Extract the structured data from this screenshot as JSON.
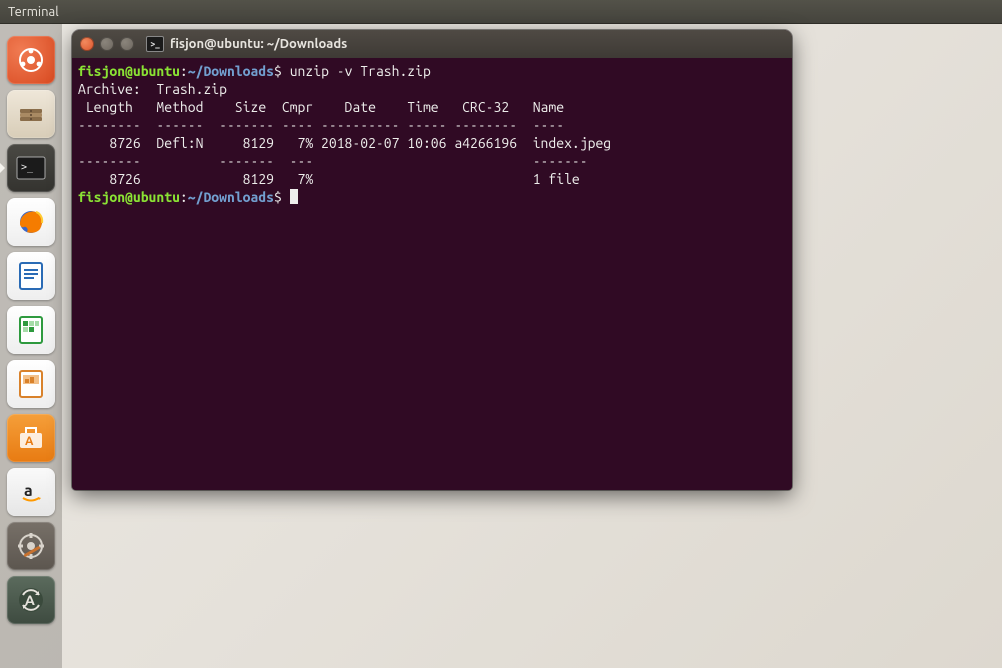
{
  "menubar": {
    "title": "Terminal"
  },
  "launcher": {
    "items": [
      {
        "name": "dash-icon",
        "cls": "li-dash"
      },
      {
        "name": "files-icon",
        "cls": "li-files"
      },
      {
        "name": "terminal-icon",
        "cls": "li-term",
        "active": true
      },
      {
        "name": "firefox-icon",
        "cls": "li-fox"
      },
      {
        "name": "writer-icon",
        "cls": "li-writer"
      },
      {
        "name": "calc-icon",
        "cls": "li-calc"
      },
      {
        "name": "impress-icon",
        "cls": "li-impress"
      },
      {
        "name": "software-icon",
        "cls": "li-soft"
      },
      {
        "name": "amazon-icon",
        "cls": "li-amazon"
      },
      {
        "name": "settings-icon",
        "cls": "li-settings"
      },
      {
        "name": "updater-icon",
        "cls": "li-update"
      }
    ]
  },
  "terminal": {
    "window_title": "fisjon@ubuntu: ~/Downloads",
    "prompt_user_host": "fisjon@ubuntu",
    "prompt_sep": ":",
    "prompt_path": "~/Downloads",
    "prompt_dollar": "$",
    "cmd1": "unzip -v Trash.zip",
    "archive_line": "Archive:  Trash.zip",
    "header": " Length   Method    Size  Cmpr    Date    Time   CRC-32   Name",
    "divider": "--------  ------  ------- ---- ---------- ----- --------  ----",
    "row": "    8726  Defl:N     8129   7% 2018-02-07 10:06 a4266196  index.jpeg",
    "footer_divider": "--------          -------  ---                            -------",
    "footer": "    8726             8129   7%                            1 file"
  }
}
